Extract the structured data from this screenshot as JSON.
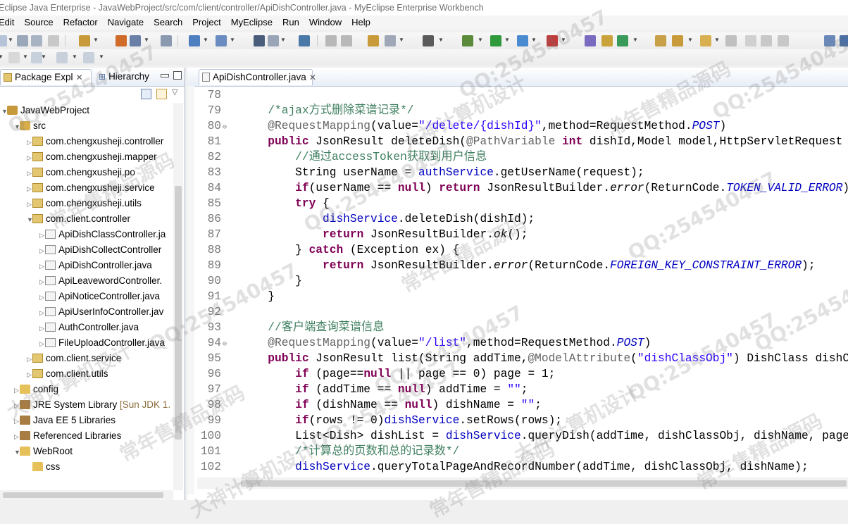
{
  "window": {
    "title": "Eclipse Java Enterprise - JavaWebProject/src/com/client/controller/ApiDishController.java - MyEclipse Enterprise Workbench"
  },
  "menu": [
    "Edit",
    "Source",
    "Refactor",
    "Navigate",
    "Search",
    "Project",
    "MyEclipse",
    "Run",
    "Window",
    "Help"
  ],
  "left_panel": {
    "tab_package": "Package Expl",
    "tab_hierarchy": "Hierarchy",
    "tree": [
      {
        "label": "JavaWebProject",
        "icon": "project-icon",
        "indent": 0,
        "twist": "▼"
      },
      {
        "label": "src",
        "icon": "source-folder-icon",
        "indent": 1,
        "twist": "▼"
      },
      {
        "label": "com.chengxusheji.controller",
        "icon": "package-icon",
        "indent": 2,
        "twist": "▷"
      },
      {
        "label": "com.chengxusheji.mapper",
        "icon": "package-icon",
        "indent": 2,
        "twist": "▷"
      },
      {
        "label": "com.chengxusheji.po",
        "icon": "package-icon",
        "indent": 2,
        "twist": "▷"
      },
      {
        "label": "com.chengxusheji.service",
        "icon": "package-icon",
        "indent": 2,
        "twist": "▷"
      },
      {
        "label": "com.chengxusheji.utils",
        "icon": "package-icon",
        "indent": 2,
        "twist": "▷"
      },
      {
        "label": "com.client.controller",
        "icon": "package-icon",
        "indent": 2,
        "twist": "▼"
      },
      {
        "label": "ApiDishClassController.ja",
        "icon": "java-file-icon",
        "indent": 3,
        "twist": "▷"
      },
      {
        "label": "ApiDishCollectController",
        "icon": "java-file-icon",
        "indent": 3,
        "twist": "▷"
      },
      {
        "label": "ApiDishController.java",
        "icon": "java-file-icon",
        "indent": 3,
        "twist": "▷"
      },
      {
        "label": "ApiLeavewordController.",
        "icon": "java-file-icon",
        "indent": 3,
        "twist": "▷"
      },
      {
        "label": "ApiNoticeController.java",
        "icon": "java-file-icon",
        "indent": 3,
        "twist": "▷"
      },
      {
        "label": "ApiUserInfoController.jav",
        "icon": "java-file-icon",
        "indent": 3,
        "twist": "▷"
      },
      {
        "label": "AuthController.java",
        "icon": "java-file-icon",
        "indent": 3,
        "twist": "▷"
      },
      {
        "label": "FileUploadController.java",
        "icon": "java-file-icon",
        "indent": 3,
        "twist": "▷"
      },
      {
        "label": "com.client.service",
        "icon": "package-icon",
        "indent": 2,
        "twist": "▷"
      },
      {
        "label": "com.client.utils",
        "icon": "package-icon",
        "indent": 2,
        "twist": "▷"
      },
      {
        "label": "config",
        "icon": "folder-icon",
        "indent": 1,
        "twist": "▷"
      },
      {
        "label": "JRE System Library",
        "suffix": " [Sun JDK 1.",
        "icon": "library-icon",
        "indent": 1,
        "twist": "▷"
      },
      {
        "label": "Java EE 5 Libraries",
        "icon": "library-icon",
        "indent": 1,
        "twist": "▷"
      },
      {
        "label": "Referenced Libraries",
        "icon": "library-icon",
        "indent": 1,
        "twist": "▷"
      },
      {
        "label": "WebRoot",
        "icon": "folder-icon",
        "indent": 1,
        "twist": "▼"
      },
      {
        "label": "css",
        "icon": "folder-icon",
        "indent": 2,
        "twist": ""
      }
    ]
  },
  "editor": {
    "tab": "ApiDishController.java",
    "lines": [
      {
        "n": "78",
        "fold": "",
        "tokens": []
      },
      {
        "n": "79",
        "fold": "",
        "tokens": [
          [
            "",
            "    "
          ],
          [
            "cm",
            "/*ajax方式删除菜谱记录*/"
          ]
        ]
      },
      {
        "n": "80",
        "fold": "⊖",
        "tokens": [
          [
            "",
            "    "
          ],
          [
            "an",
            "@RequestMapping"
          ],
          [
            "",
            "(value="
          ],
          [
            "st",
            "\"/delete/{dishId}\""
          ],
          [
            "",
            ",method=RequestMethod."
          ],
          [
            "ifd",
            "POST"
          ],
          [
            "",
            ")"
          ]
        ]
      },
      {
        "n": "81",
        "fold": "",
        "tokens": [
          [
            "",
            "    "
          ],
          [
            "kw",
            "public"
          ],
          [
            "",
            " JsonResult deleteDish("
          ],
          [
            "an",
            "@PathVariable"
          ],
          [
            "",
            " "
          ],
          [
            "kw",
            "int"
          ],
          [
            "",
            " dishId,Model model,HttpServletRequest request) {"
          ]
        ]
      },
      {
        "n": "82",
        "fold": "",
        "tokens": [
          [
            "",
            "        "
          ],
          [
            "cm",
            "//通过accessToken获取到用户信息"
          ]
        ]
      },
      {
        "n": "83",
        "fold": "",
        "tokens": [
          [
            "",
            "        String userName = "
          ],
          [
            "fd",
            "authService"
          ],
          [
            "",
            ".getUserName(request);"
          ]
        ]
      },
      {
        "n": "84",
        "fold": "",
        "tokens": [
          [
            "",
            "        "
          ],
          [
            "kw",
            "if"
          ],
          [
            "",
            "(userName == "
          ],
          [
            "kw",
            "null"
          ],
          [
            "",
            ") "
          ],
          [
            "kw",
            "return"
          ],
          [
            "",
            " JsonResultBuilder."
          ],
          [
            "it",
            "error"
          ],
          [
            "",
            "(ReturnCode."
          ],
          [
            "ifd",
            "TOKEN_VALID_ERROR"
          ],
          [
            "",
            ");"
          ]
        ]
      },
      {
        "n": "85",
        "fold": "",
        "tokens": [
          [
            "",
            "        "
          ],
          [
            "kw",
            "try"
          ],
          [
            "",
            " {"
          ]
        ]
      },
      {
        "n": "86",
        "fold": "",
        "tokens": [
          [
            "",
            "            "
          ],
          [
            "fd",
            "dishService"
          ],
          [
            "",
            ".deleteDish(dishId);"
          ]
        ]
      },
      {
        "n": "87",
        "fold": "",
        "tokens": [
          [
            "",
            "            "
          ],
          [
            "kw",
            "return"
          ],
          [
            "",
            " JsonResultBuilder."
          ],
          [
            "it",
            "ok"
          ],
          [
            "",
            "();"
          ]
        ]
      },
      {
        "n": "88",
        "fold": "",
        "tokens": [
          [
            "",
            "        } "
          ],
          [
            "kw",
            "catch"
          ],
          [
            "",
            " (Exception ex) {"
          ]
        ]
      },
      {
        "n": "89",
        "fold": "",
        "tokens": [
          [
            "",
            "            "
          ],
          [
            "kw",
            "return"
          ],
          [
            "",
            " JsonResultBuilder."
          ],
          [
            "it",
            "error"
          ],
          [
            "",
            "(ReturnCode."
          ],
          [
            "ifd",
            "FOREIGN_KEY_CONSTRAINT_ERROR"
          ],
          [
            "",
            ");"
          ]
        ]
      },
      {
        "n": "90",
        "fold": "",
        "tokens": [
          [
            "",
            "        }"
          ]
        ]
      },
      {
        "n": "91",
        "fold": "",
        "tokens": [
          [
            "",
            "    }"
          ]
        ]
      },
      {
        "n": "92",
        "fold": "",
        "tokens": []
      },
      {
        "n": "93",
        "fold": "",
        "tokens": [
          [
            "",
            "    "
          ],
          [
            "cm",
            "//客户端查询菜谱信息"
          ]
        ]
      },
      {
        "n": "94",
        "fold": "⊖",
        "tokens": [
          [
            "",
            "    "
          ],
          [
            "an",
            "@RequestMapping"
          ],
          [
            "",
            "(value="
          ],
          [
            "st",
            "\"/list\""
          ],
          [
            "",
            ",method=RequestMethod."
          ],
          [
            "ifd",
            "POST"
          ],
          [
            "",
            ")"
          ]
        ]
      },
      {
        "n": "95",
        "fold": "",
        "tokens": [
          [
            "",
            "    "
          ],
          [
            "kw",
            "public"
          ],
          [
            "",
            " JsonResult list(String addTime,"
          ],
          [
            "an",
            "@ModelAttribute"
          ],
          [
            "",
            "("
          ],
          [
            "st",
            "\"dishClassObj\""
          ],
          [
            "",
            ") DishClass dishClassObj"
          ]
        ]
      },
      {
        "n": "96",
        "fold": "",
        "tokens": [
          [
            "",
            "        "
          ],
          [
            "kw",
            "if"
          ],
          [
            "",
            " (page=="
          ],
          [
            "kw",
            "null"
          ],
          [
            "",
            " || page == 0) page = 1;"
          ]
        ]
      },
      {
        "n": "97",
        "fold": "",
        "tokens": [
          [
            "",
            "        "
          ],
          [
            "kw",
            "if"
          ],
          [
            "",
            " (addTime == "
          ],
          [
            "kw",
            "null"
          ],
          [
            "",
            ") addTime = "
          ],
          [
            "st",
            "\"\""
          ],
          [
            "",
            ";"
          ]
        ]
      },
      {
        "n": "98",
        "fold": "",
        "tokens": [
          [
            "",
            "        "
          ],
          [
            "kw",
            "if"
          ],
          [
            "",
            " (dishName == "
          ],
          [
            "kw",
            "null"
          ],
          [
            "",
            ") dishName = "
          ],
          [
            "st",
            "\"\""
          ],
          [
            "",
            ";"
          ]
        ]
      },
      {
        "n": "99",
        "fold": "",
        "tokens": [
          [
            "",
            "        "
          ],
          [
            "kw",
            "if"
          ],
          [
            "",
            "(rows != 0)"
          ],
          [
            "fd",
            "dishService"
          ],
          [
            "",
            ".setRows(rows);"
          ]
        ]
      },
      {
        "n": "100",
        "fold": "",
        "tokens": [
          [
            "",
            "        List<Dish> dishList = "
          ],
          [
            "fd",
            "dishService"
          ],
          [
            "",
            ".queryDish(addTime, dishClassObj, dishName, page);"
          ]
        ]
      },
      {
        "n": "101",
        "fold": "",
        "tokens": [
          [
            "",
            "        "
          ],
          [
            "cm",
            "/*计算总的页数和总的记录数*/"
          ]
        ]
      },
      {
        "n": "102",
        "fold": "",
        "tokens": [
          [
            "",
            "        "
          ],
          [
            "fd",
            "dishService"
          ],
          [
            "",
            ".queryTotalPageAndRecordNumber(addTime, dishClassObj, dishName);"
          ]
        ]
      }
    ]
  },
  "watermark": {
    "lines": [
      "QQ:254540457",
      "大神计算机设计",
      "常年售精品源码"
    ]
  }
}
